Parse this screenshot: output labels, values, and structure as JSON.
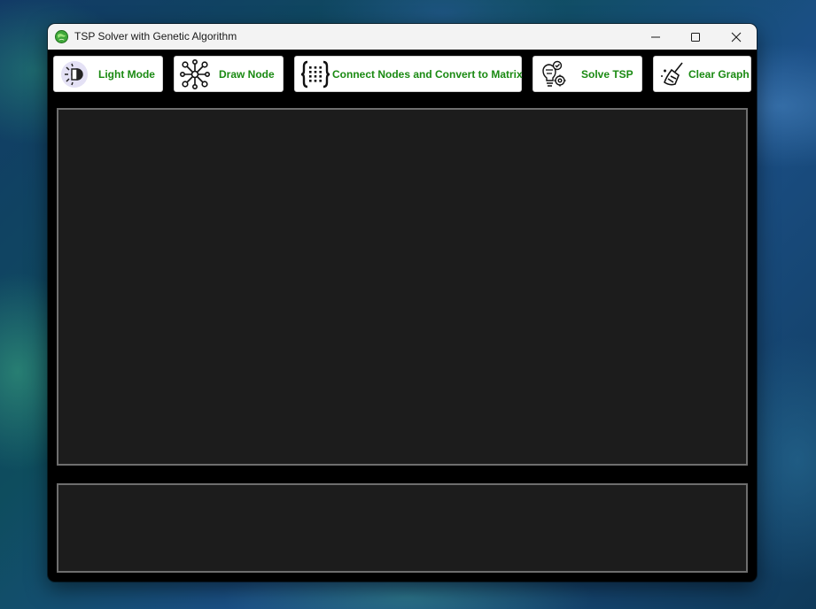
{
  "window": {
    "title": "TSP Solver with Genetic Algorithm",
    "app_icon": "green-globe-icon"
  },
  "window_controls": {
    "minimize_icon": "minimize-icon",
    "maximize_icon": "maximize-icon",
    "close_icon": "close-icon"
  },
  "toolbar": {
    "light_mode": {
      "label": "Light Mode",
      "icon": "sun-toggle-icon"
    },
    "draw_node": {
      "label": "Draw Node",
      "icon": "network-nodes-icon"
    },
    "connect_nodes": {
      "label": "Connect Nodes and Convert to Matrix",
      "icon": "matrix-braces-icon"
    },
    "solve_tsp": {
      "label": "Solve TSP",
      "icon": "lightbulb-gear-icon"
    },
    "clear_graph": {
      "label": "Clear Graph",
      "icon": "broom-icon"
    }
  },
  "colors": {
    "button_text": "#1a8a12",
    "canvas_bg": "#1c1c1c",
    "window_bg": "#000000",
    "panel_border": "#6e6e6e"
  }
}
